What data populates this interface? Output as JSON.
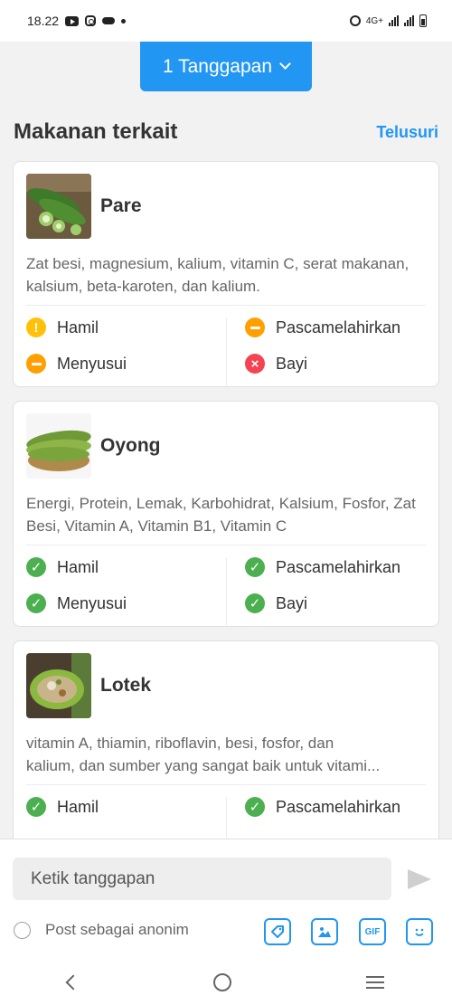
{
  "status_bar": {
    "time": "18.22",
    "network": "4G+"
  },
  "response_button": {
    "label": "1 Tanggapan"
  },
  "section": {
    "title": "Makanan terkait",
    "link": "Telusuri"
  },
  "foods": [
    {
      "name": "Pare",
      "description": "Zat besi, magnesium, kalium, vitamin C, serat makanan, kalsium, beta-karoten, dan kalium.",
      "statuses": [
        {
          "label": "Hamil",
          "level": "warning"
        },
        {
          "label": "Pascamelahirkan",
          "level": "caution"
        },
        {
          "label": "Menyusui",
          "level": "caution"
        },
        {
          "label": "Bayi",
          "level": "not-allowed"
        }
      ]
    },
    {
      "name": "Oyong",
      "description": "Energi, Protein, Lemak, Karbohidrat, Kalsium, Fosfor, Zat Besi, Vitamin A, Vitamin B1, Vitamin C",
      "statuses": [
        {
          "label": "Hamil",
          "level": "safe"
        },
        {
          "label": "Pascamelahirkan",
          "level": "safe"
        },
        {
          "label": "Menyusui",
          "level": "safe"
        },
        {
          "label": "Bayi",
          "level": "safe"
        }
      ]
    },
    {
      "name": "Lotek",
      "description_line1": "vitamin A, thiamin, riboflavin, besi, fosfor, dan",
      "description_line2": "kalium, dan sumber yang sangat baik untuk vitami...",
      "statuses": [
        {
          "label": "Hamil",
          "level": "safe"
        },
        {
          "label": "Pascamelahirkan",
          "level": "safe"
        }
      ]
    }
  ],
  "composer": {
    "placeholder": "Ketik tanggapan",
    "anon_label": "Post sebagai anonim",
    "gif_label": "GIF"
  },
  "colors": {
    "accent": "#2196f3",
    "safe": "#4caf50",
    "warning": "#ffc107",
    "caution": "#ffa000",
    "not_allowed": "#f44352"
  }
}
